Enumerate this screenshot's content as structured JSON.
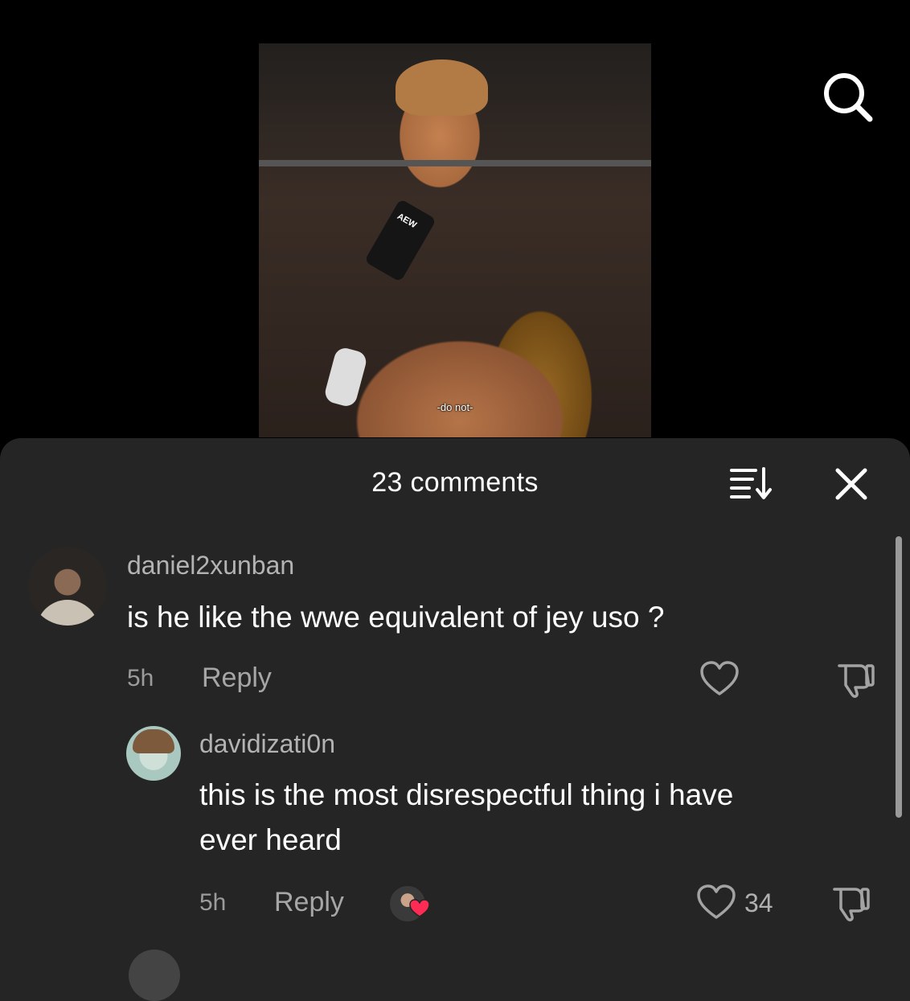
{
  "video": {
    "subtitle": "-do not-",
    "mic_logo": "AEW"
  },
  "top_bar": {
    "search_icon": "search-icon"
  },
  "comments_panel": {
    "title": "23 comments",
    "sort_icon": "sort-icon",
    "close_icon": "close-icon"
  },
  "comments": [
    {
      "username": "daniel2xunban",
      "text": "is he like the wwe equivalent of jey uso ?",
      "time": "5h",
      "reply_label": "Reply",
      "likes": ""
    },
    {
      "username": "davidizati0n",
      "text_line1": "this is the most disrespectful thing i have",
      "text_line2": "ever heard",
      "time": "5h",
      "reply_label": "Reply",
      "likes": "34"
    }
  ],
  "colors": {
    "background": "#000000",
    "sheet": "#252525",
    "heart_red": "#fe2c55"
  }
}
